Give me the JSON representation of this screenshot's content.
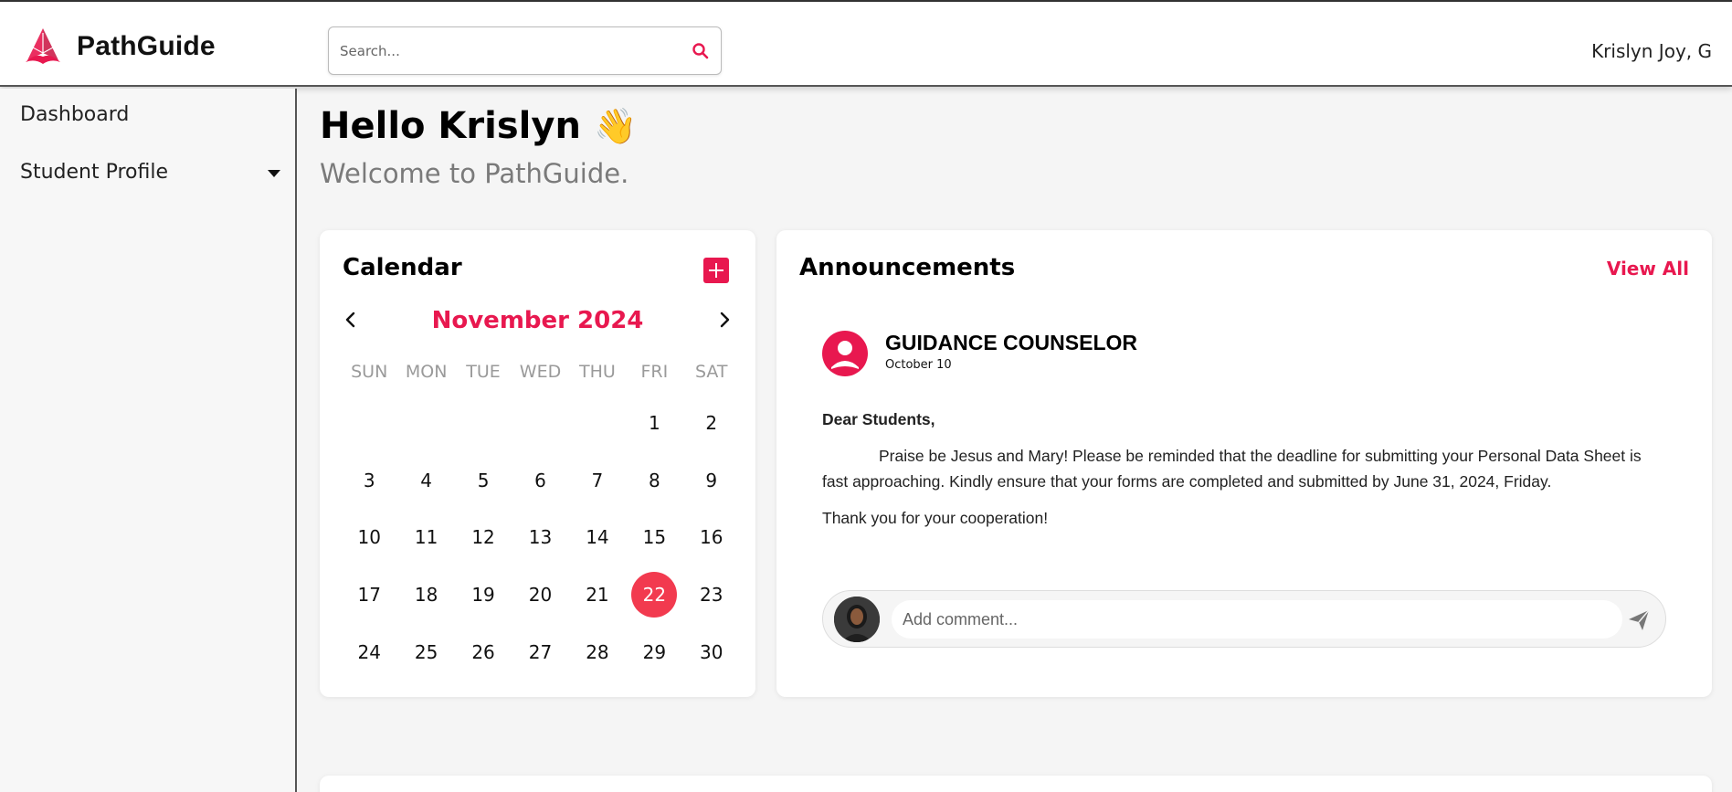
{
  "app": {
    "name": "PathGuide",
    "accent": "#e8184f"
  },
  "header": {
    "search_placeholder": "Search...",
    "user_name": "Krislyn Joy, G"
  },
  "sidebar": {
    "items": [
      {
        "label": "Dashboard",
        "has_dropdown": false
      },
      {
        "label": "Student Profile",
        "has_dropdown": true
      }
    ]
  },
  "main": {
    "greeting": "Hello Krislyn",
    "greeting_emoji": "👋",
    "welcome": "Welcome to PathGuide."
  },
  "calendar": {
    "title": "Calendar",
    "month_label": "November 2024",
    "weekdays": [
      "SUN",
      "MON",
      "TUE",
      "WED",
      "THU",
      "FRI",
      "SAT"
    ],
    "leading_blanks": 5,
    "days_in_month": 30,
    "selected_day": 22
  },
  "announcements": {
    "title": "Announcements",
    "view_all": "View All",
    "post": {
      "author": "GUIDANCE COUNSELOR",
      "date": "October 10",
      "greeting": "Dear Students,",
      "body": "Praise be Jesus and Mary! Please be reminded that the deadline for submitting your Personal Data Sheet is fast approaching. Kindly ensure that your forms are completed and submitted by June 31, 2024, Friday.",
      "closing": "Thank you for your cooperation!"
    },
    "comment_placeholder": "Add comment..."
  }
}
